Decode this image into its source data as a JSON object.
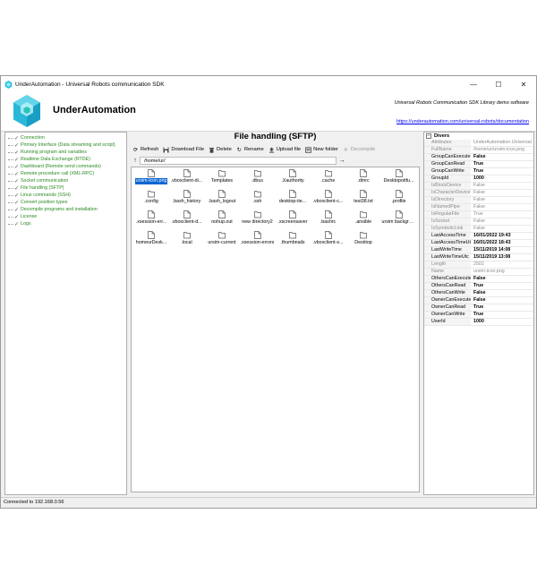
{
  "window": {
    "title": "UnderAutomation - Universal Robots communication SDK",
    "minimize_glyph": "—",
    "maximize_glyph": "☐",
    "close_glyph": "✕"
  },
  "header": {
    "brand": "UnderAutomation",
    "tagline": "Universal Robots Communication SDK Library demo software",
    "link": "https://underautomation.com/universal-robots/documentation"
  },
  "nav": {
    "items": [
      {
        "label": "Connection"
      },
      {
        "label": "Primary Interface (Data streaming and script)"
      },
      {
        "label": "Running program and variables"
      },
      {
        "label": "Realtime Data Exchange (RTDE)"
      },
      {
        "label": "Dashboard (Remote send commands)"
      },
      {
        "label": "Remote procedure call (XML-RPC)"
      },
      {
        "label": "Socket communication"
      },
      {
        "label": "File handling (SFTP)"
      },
      {
        "label": "Linux commands (SSH)"
      },
      {
        "label": "Convert position types"
      },
      {
        "label": "Decompile programs and installation"
      },
      {
        "label": "License"
      },
      {
        "label": "Logs"
      }
    ]
  },
  "main": {
    "title": "File handling (SFTP)",
    "toolbar": {
      "refresh": "Refresh",
      "download": "Download File",
      "delete": "Delete",
      "rename": "Rename",
      "upload": "Upload file",
      "new_folder": "New folder",
      "decompile": "Decompile"
    },
    "path": "/home/ur/",
    "files": [
      {
        "name": "ursim-icon.png",
        "type": "file",
        "selected": true
      },
      {
        "name": ".vboxclient-di...",
        "type": "file"
      },
      {
        "name": "Templates",
        "type": "folder"
      },
      {
        "name": ".dbus",
        "type": "folder"
      },
      {
        "name": ".Xauthority",
        "type": "file"
      },
      {
        "name": ".cache",
        "type": "folder"
      },
      {
        "name": ".dmrc",
        "type": "file"
      },
      {
        "name": "Desktopotifu...",
        "type": "file"
      },
      {
        "name": ".config",
        "type": "folder"
      },
      {
        "name": ".bash_history",
        "type": "file"
      },
      {
        "name": ".bash_logout",
        "type": "file"
      },
      {
        "name": ".ssh",
        "type": "folder"
      },
      {
        "name": "desktop-ite...",
        "type": "file"
      },
      {
        "name": ".vboxclient-c...",
        "type": "file"
      },
      {
        "name": "test38.txt",
        "type": "file"
      },
      {
        "name": ".profile",
        "type": "file"
      },
      {
        "name": ".xsession-err...",
        "type": "file"
      },
      {
        "name": ".vboxclient-d...",
        "type": "file"
      },
      {
        "name": "nohup.out",
        "type": "file"
      },
      {
        "name": "new directory2",
        "type": "folder"
      },
      {
        "name": ".xscreensaver",
        "type": "file"
      },
      {
        "name": ".bashrc",
        "type": "file"
      },
      {
        "name": ".ansible",
        "type": "folder"
      },
      {
        "name": "ursim background....",
        "type": "file"
      },
      {
        "name": "homeurDesk...",
        "type": "file"
      },
      {
        "name": ".local",
        "type": "folder"
      },
      {
        "name": "ursim-current",
        "type": "folder"
      },
      {
        "name": ".xsession-errors",
        "type": "file"
      },
      {
        "name": ".thumbnails",
        "type": "folder"
      },
      {
        "name": ".vboxclient-s...",
        "type": "file"
      },
      {
        "name": "Desktop",
        "type": "folder"
      }
    ]
  },
  "properties": {
    "category": "Divers",
    "rows": [
      {
        "key": "Attributes",
        "value": "UnderAutomation.Universal",
        "readonly": true
      },
      {
        "key": "FullName",
        "value": "/home/ur/ursim-icon.png",
        "readonly": true
      },
      {
        "key": "GroupCanExecute",
        "value": "False",
        "readonly": false
      },
      {
        "key": "GroupCanRead",
        "value": "True",
        "readonly": false
      },
      {
        "key": "GroupCanWrite",
        "value": "True",
        "readonly": false
      },
      {
        "key": "GroupId",
        "value": "1000",
        "readonly": false
      },
      {
        "key": "IsBlockDevice",
        "value": "False",
        "readonly": true
      },
      {
        "key": "IsCharacterDevice",
        "value": "False",
        "readonly": true
      },
      {
        "key": "IsDirectory",
        "value": "False",
        "readonly": true
      },
      {
        "key": "IsNamedPipe",
        "value": "False",
        "readonly": true
      },
      {
        "key": "IsRegularFile",
        "value": "True",
        "readonly": true
      },
      {
        "key": "IsSocket",
        "value": "False",
        "readonly": true
      },
      {
        "key": "IsSymbolicLink",
        "value": "False",
        "readonly": true
      },
      {
        "key": "LastAccessTime",
        "value": "16/01/2022 19:43",
        "readonly": false
      },
      {
        "key": "LastAccessTimeUtc",
        "value": "16/01/2022 18:43",
        "readonly": false
      },
      {
        "key": "LastWriteTime",
        "value": "15/11/2019 14:08",
        "readonly": false
      },
      {
        "key": "LastWriteTimeUtc",
        "value": "15/11/2019 13:08",
        "readonly": false
      },
      {
        "key": "Length",
        "value": "2502",
        "readonly": true
      },
      {
        "key": "Name",
        "value": "ursim-icon.png",
        "readonly": true
      },
      {
        "key": "OthersCanExecute",
        "value": "False",
        "readonly": false
      },
      {
        "key": "OthersCanRead",
        "value": "True",
        "readonly": false
      },
      {
        "key": "OthersCanWrite",
        "value": "False",
        "readonly": false
      },
      {
        "key": "OwnerCanExecute",
        "value": "False",
        "readonly": false
      },
      {
        "key": "OwnerCanRead",
        "value": "True",
        "readonly": false
      },
      {
        "key": "OwnerCanWrite",
        "value": "True",
        "readonly": false
      },
      {
        "key": "UserId",
        "value": "1000",
        "readonly": false
      }
    ]
  },
  "status": {
    "text": "Connected to 192.168.0.56"
  },
  "colors": {
    "nav_text": "#2a8a22",
    "selection": "#0a64d2",
    "link": "#0000ee"
  }
}
